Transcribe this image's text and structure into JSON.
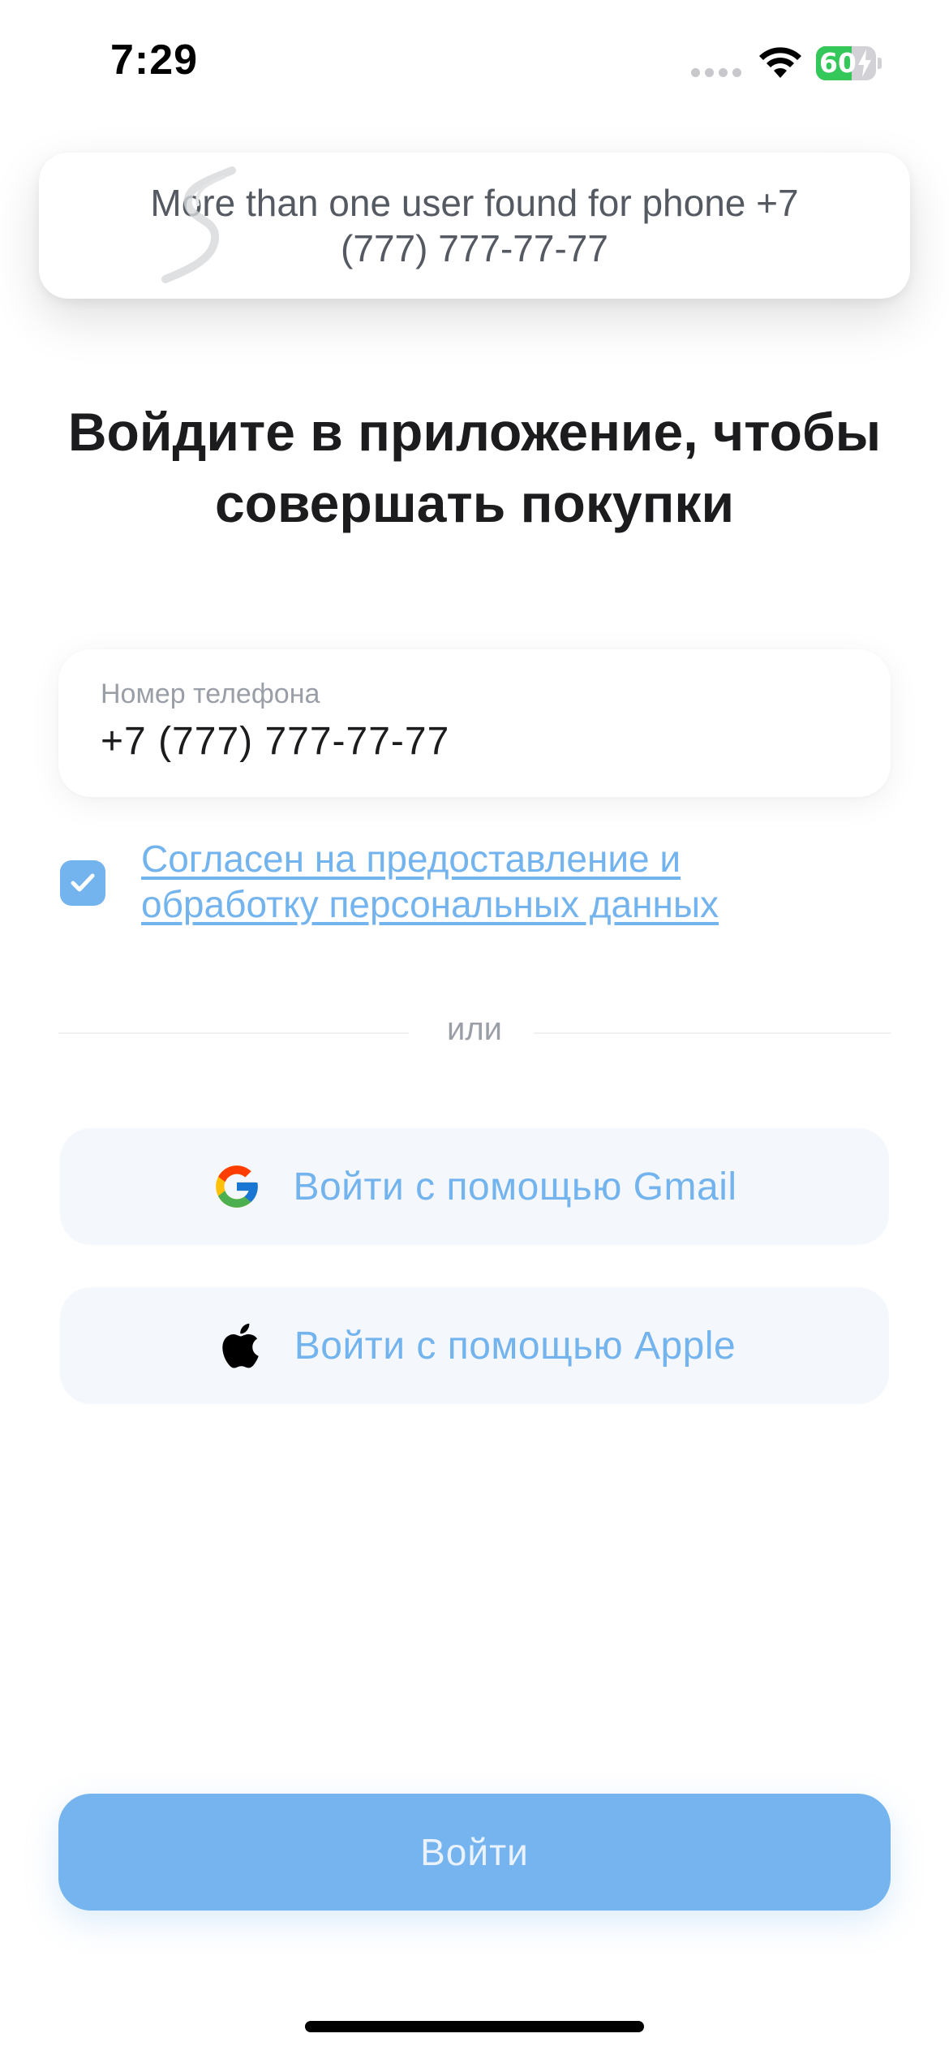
{
  "status_bar": {
    "time": "7:29",
    "battery_percent": "60",
    "battery_level": 0.6,
    "battery_color": "#34c759",
    "wifi_icon": "wifi-icon",
    "charging_icon": "bolt-icon"
  },
  "toast": {
    "message": "More than one user found for phone +7 (777) 777-77-77",
    "logo_icon": "brand-logo-watermark"
  },
  "title": "Войдите в приложение, чтобы совершать покупки",
  "phone_field": {
    "label": "Номер телефона",
    "value": "+7 (777) 777-77-77"
  },
  "consent": {
    "checked": true,
    "link_text": "Согласен на предоставление и обработку персональных данных"
  },
  "divider_text": "или",
  "social": {
    "gmail_label": "Войти с помощью Gmail",
    "gmail_icon": "google-icon",
    "apple_label": "Войти с помощью Apple",
    "apple_icon": "apple-icon"
  },
  "login_button": {
    "label": "Войти"
  },
  "colors": {
    "accent": "#73b3ee",
    "button_bg": "#75b4ef",
    "social_bg": "#f4f8fd",
    "text": "#1c1c1e"
  }
}
